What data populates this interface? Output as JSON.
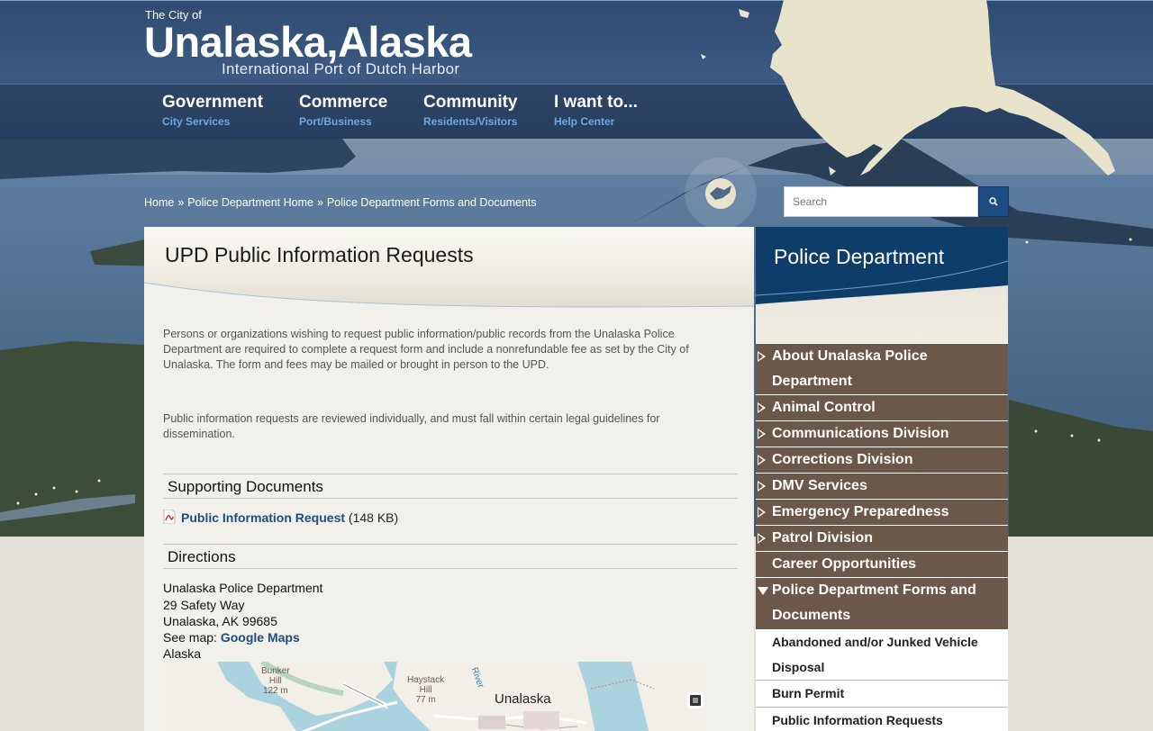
{
  "header": {
    "city_prefix": "The City of",
    "city_name": "Unalaska,Alaska",
    "tagline": "International Port of Dutch Harbor"
  },
  "nav": [
    {
      "title": "Government",
      "subtitle": "City Services"
    },
    {
      "title": "Commerce",
      "subtitle": "Port/Business"
    },
    {
      "title": "Community",
      "subtitle": "Residents/Visitors"
    },
    {
      "title": "I want to...",
      "subtitle": "Help Center"
    }
  ],
  "breadcrumb": [
    "Home",
    "Police Department Home",
    "Police Department Forms and Documents"
  ],
  "breadcrumb_separator": "»",
  "search": {
    "placeholder": "Search",
    "icon": "search-icon"
  },
  "main": {
    "title": "UPD Public Information Requests",
    "paragraph1": "Persons or organizations wishing to request public information/public records from the Unalaska Police Department are required to complete a request form and include a nonrefundable fee as set by the City of Unalaska. The form and fees may be mailed or brought in person to the UPD.",
    "paragraph2": "Public information requests are reviewed individually, and must fall within certain legal guidelines for dissemination.",
    "supporting_heading": "Supporting Documents",
    "document": {
      "icon": "pdf-icon",
      "label": "Public Information Request",
      "size": "(148 KB)"
    },
    "directions_heading": "Directions",
    "address": [
      "Unalaska Police Department",
      "29 Safety Way",
      "Unalaska, AK 99685"
    ],
    "see_map_prefix": "See map:",
    "see_map_link": "Google Maps",
    "region": "Alaska",
    "map_labels": {
      "hill1_name_a": "Bunker",
      "hill1_name_b": "Hill",
      "hill1_elev": "122 m",
      "hill2_name_a": "Haystack",
      "hill2_name_b": "Hill",
      "hill2_elev": "77 m",
      "town": "Unalaska",
      "river": "River"
    }
  },
  "sidebar": {
    "title": "Police Department",
    "items": [
      {
        "label": "About Unalaska Police Department",
        "has_children": true
      },
      {
        "label": "Animal Control",
        "has_children": true
      },
      {
        "label": "Communications Division",
        "has_children": true
      },
      {
        "label": "Corrections Division",
        "has_children": true
      },
      {
        "label": "DMV Services",
        "has_children": true
      },
      {
        "label": "Emergency Preparedness",
        "has_children": true
      },
      {
        "label": "Patrol Division",
        "has_children": true
      },
      {
        "label": "Career Opportunities",
        "has_children": false
      },
      {
        "label": "Police Department Forms and Documents",
        "has_children": true,
        "expanded": true
      }
    ],
    "subitems": [
      "Abandoned and/or Junked Vehicle Disposal",
      "Burn Permit",
      "Public Information Requests"
    ]
  },
  "colors": {
    "header_blue": "#3c5a82",
    "nav_subtitle": "#6fa7e3",
    "sidebar_brown": "#6b584a",
    "sidebar_head_blue": "#0f3d6a",
    "link_blue": "#1d4e80",
    "search_button": "#1e4c82"
  }
}
